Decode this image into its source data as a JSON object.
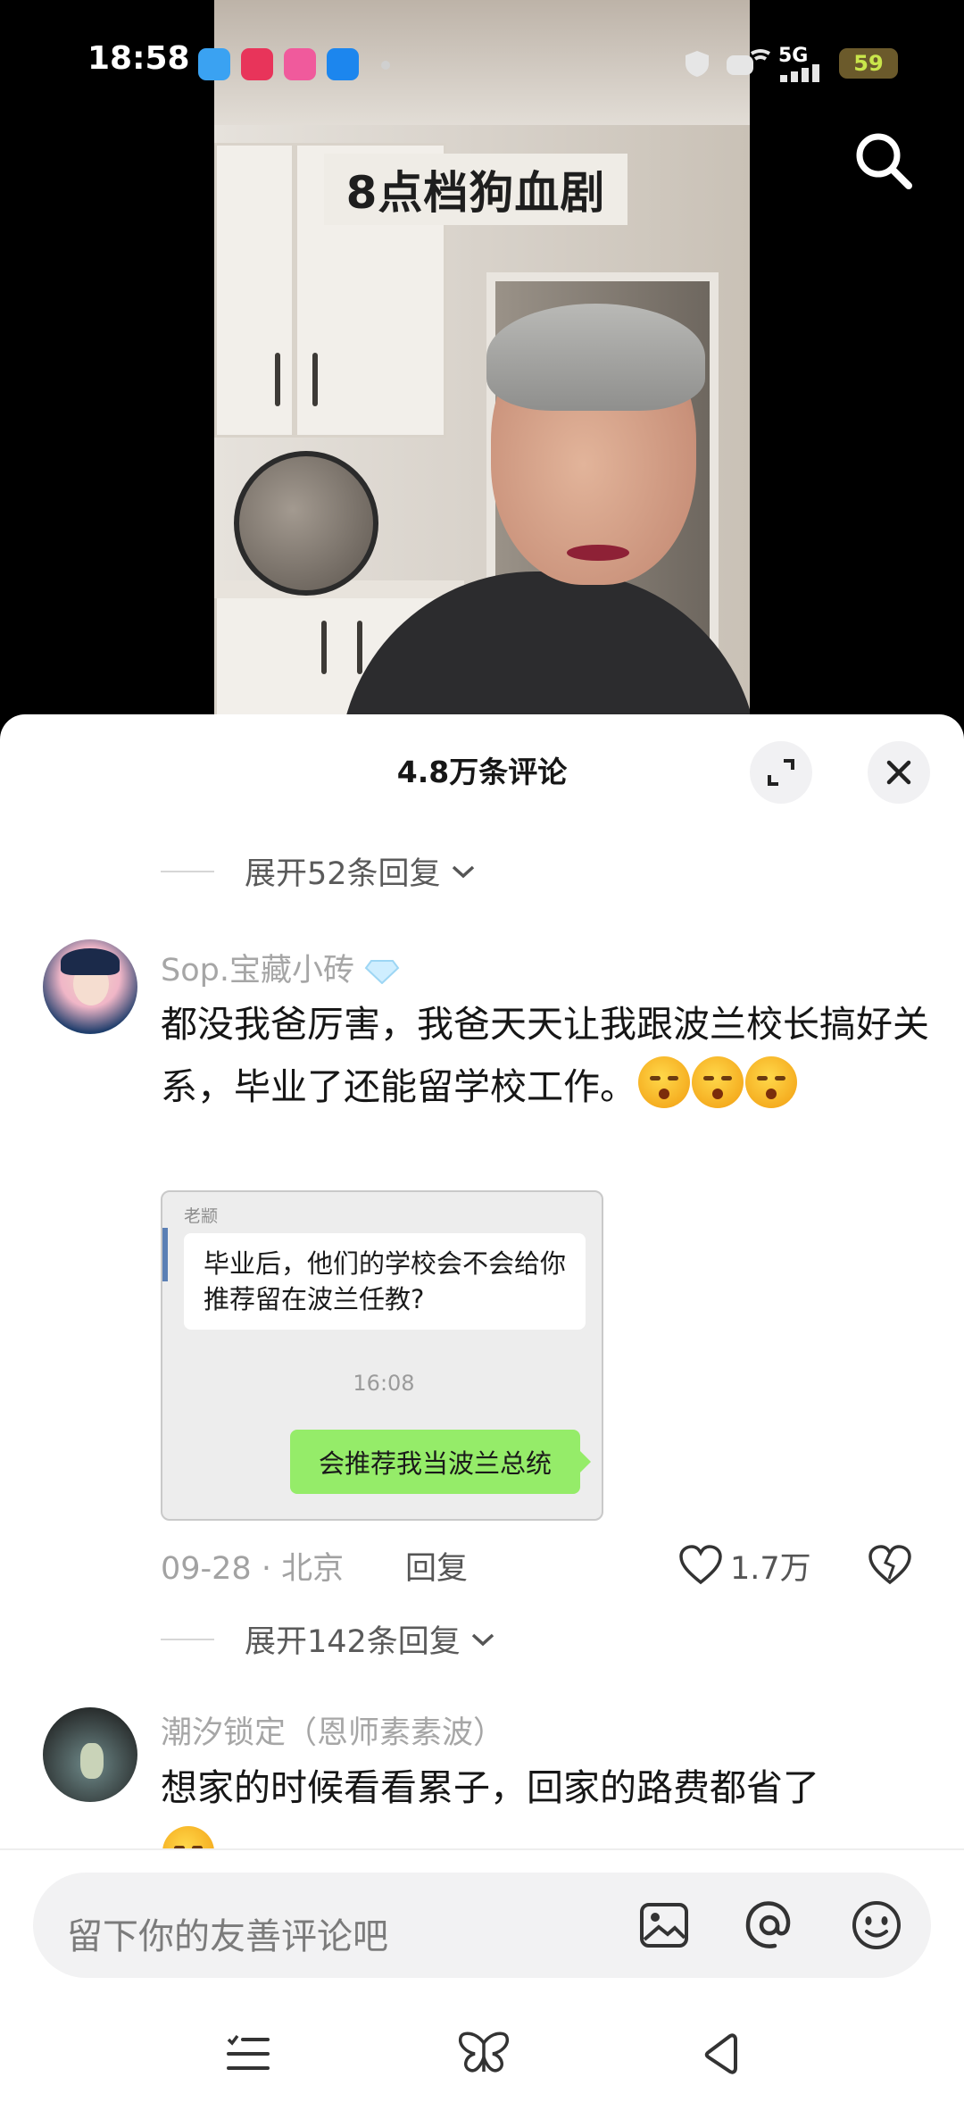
{
  "status_bar": {
    "time": "18:58",
    "network": "5G",
    "battery": "59",
    "notification_apps": [
      "weather",
      "music",
      "camera",
      "browser"
    ]
  },
  "video": {
    "title": "8点档狗血剧"
  },
  "comments_panel": {
    "title": "4.8万条评论",
    "expand_top": "展开52条回复",
    "comments": [
      {
        "username": "Sop.宝藏小砖",
        "text": "都没我爸厉害，我爸天天让我跟波兰校长搞好关系，毕业了还能留学校工作。",
        "date_location": "09-28 · 北京",
        "reply_label": "回复",
        "likes": "1.7万",
        "image": {
          "sender": "老颛",
          "question": "毕业后，他们的学校会不会给你推荐留在波兰任教?",
          "time": "16:08",
          "answer": "会推荐我当波兰总统"
        },
        "expand_replies": "展开142条回复"
      },
      {
        "username": "潮汐锁定（恩师素素波）",
        "text": "想家的时候看看累子，回家的路费都省了"
      }
    ]
  },
  "input": {
    "placeholder": "留下你的友善评论吧"
  },
  "colors": {
    "sheet_bg": "#ffffff",
    "chat_green": "#95ec69",
    "emoji_yellow": "#f4a81b"
  }
}
